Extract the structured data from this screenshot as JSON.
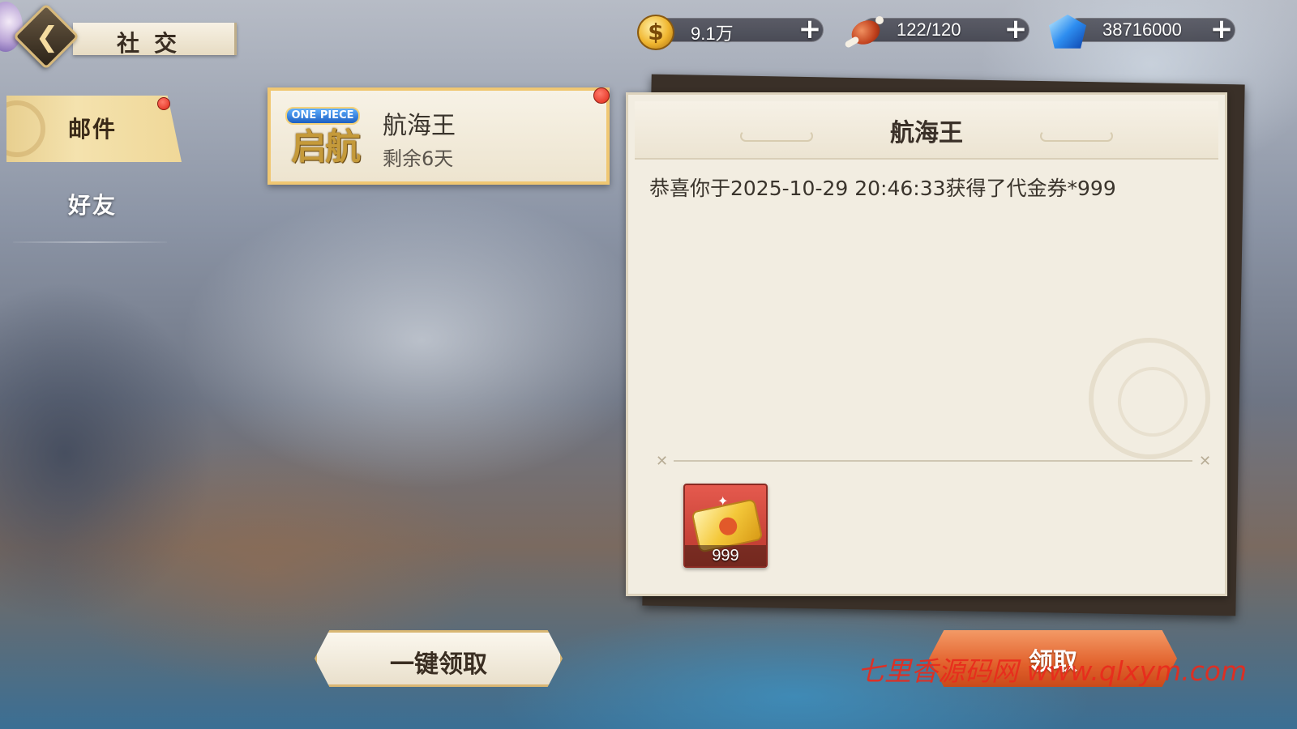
{
  "header": {
    "title": "社交"
  },
  "resources": [
    {
      "name": "gold",
      "icon": "gold-coin-icon",
      "value": "9.1万",
      "add_label": "+"
    },
    {
      "name": "stamina",
      "icon": "meat-icon",
      "value": "122/120",
      "add_label": "+"
    },
    {
      "name": "diamond",
      "icon": "diamond-icon",
      "value": "38716000",
      "add_label": "+"
    }
  ],
  "tabs": [
    {
      "label": "邮件",
      "selected": true,
      "has_notification": true
    },
    {
      "label": "好友",
      "selected": false,
      "has_notification": false
    }
  ],
  "mail_list": [
    {
      "logo_top": "ONE PIECE",
      "logo_bottom": "启航",
      "sender": "航海王",
      "remaining": "剩余6天",
      "unread": true
    }
  ],
  "mail_detail": {
    "title": "航海王",
    "body": "恭喜你于2025-10-29  20:46:33获得了代金券*999",
    "rewards": [
      {
        "icon": "voucher-icon",
        "count": "999"
      }
    ]
  },
  "buttons": {
    "claim_all": "一键领取",
    "claim": "领取"
  },
  "watermark": "七里香源码网 www.qlxym.com",
  "colors": {
    "tab_selected": "#f0d898",
    "claim_button": "#e2612c",
    "notification_dot": "#e02818",
    "panel_bg": "#f2ede1",
    "reward_bg": "#c9463a"
  }
}
